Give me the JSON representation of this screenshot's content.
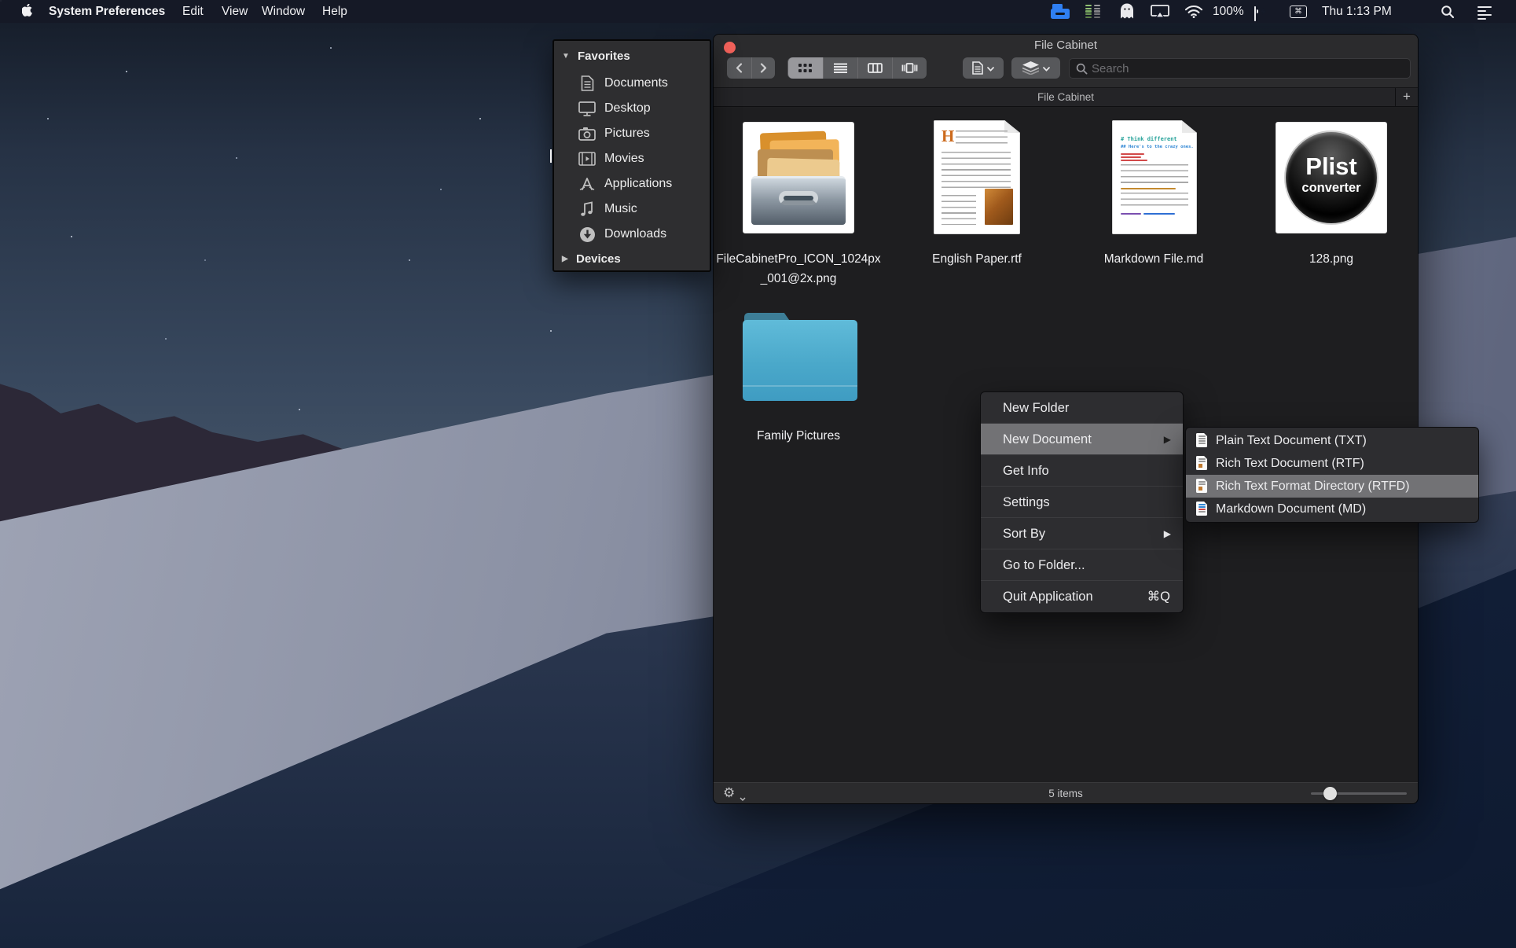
{
  "colors": {
    "menu_highlight": "#727275",
    "folder_blue": "#4aa8ca",
    "traffic_light_red": "#f3625b",
    "app_menu_icon_blue": "#2f7ff2",
    "selected_segment": "#98989c"
  },
  "menu_bar": {
    "apple_icon": "apple-icon",
    "app_name": "System Preferences",
    "menus": [
      {
        "label": "Edit"
      },
      {
        "label": "View"
      },
      {
        "label": "Window"
      },
      {
        "label": "Help"
      }
    ],
    "status": {
      "battery_percent": "100%",
      "clock": "Thu 1:13 PM"
    }
  },
  "sidebar_panel": {
    "favorites_header": "Favorites",
    "items": [
      {
        "label": "Documents",
        "icon": "document-icon"
      },
      {
        "label": "Desktop",
        "icon": "display-icon"
      },
      {
        "label": "Pictures",
        "icon": "camera-icon"
      },
      {
        "label": "Movies",
        "icon": "film-icon"
      },
      {
        "label": "Applications",
        "icon": "applications-icon"
      },
      {
        "label": "Music",
        "icon": "music-note-icon"
      },
      {
        "label": "Downloads",
        "icon": "download-circle-icon"
      }
    ],
    "devices_header": "Devices"
  },
  "window": {
    "title": "File Cabinet",
    "toolbar": {
      "search_placeholder": "Search"
    },
    "tab_bar": {
      "active_tab": "File Cabinet",
      "add_tab_label": "+"
    },
    "files": [
      {
        "name": "FileCabinetPro_ICON_1024px_001@2x.png"
      },
      {
        "name": "English Paper.rtf",
        "preview_dropcap": "H"
      },
      {
        "name": "Markdown File.md",
        "preview_h1": "# Think different",
        "preview_h2": "## Here's to the crazy ones."
      },
      {
        "name": "128.png",
        "icon_title": "Plist",
        "icon_subtitle": "converter"
      }
    ],
    "folders": [
      {
        "name": "Family Pictures"
      }
    ],
    "status_bar": {
      "item_count": "5 items"
    }
  },
  "context_menu": {
    "items": [
      {
        "label": "New Folder"
      },
      {
        "label": "New Document"
      },
      {
        "label": "Get Info"
      },
      {
        "label": "Settings"
      },
      {
        "label": "Sort By"
      },
      {
        "label": "Go to Folder..."
      },
      {
        "label": "Quit Application",
        "shortcut": "⌘Q"
      }
    ]
  },
  "submenu": {
    "items": [
      {
        "label": "Plain Text Document (TXT)"
      },
      {
        "label": "Rich Text Document (RTF)"
      },
      {
        "label": "Rich Text Format Directory (RTFD)"
      },
      {
        "label": "Markdown Document (MD)"
      }
    ]
  }
}
